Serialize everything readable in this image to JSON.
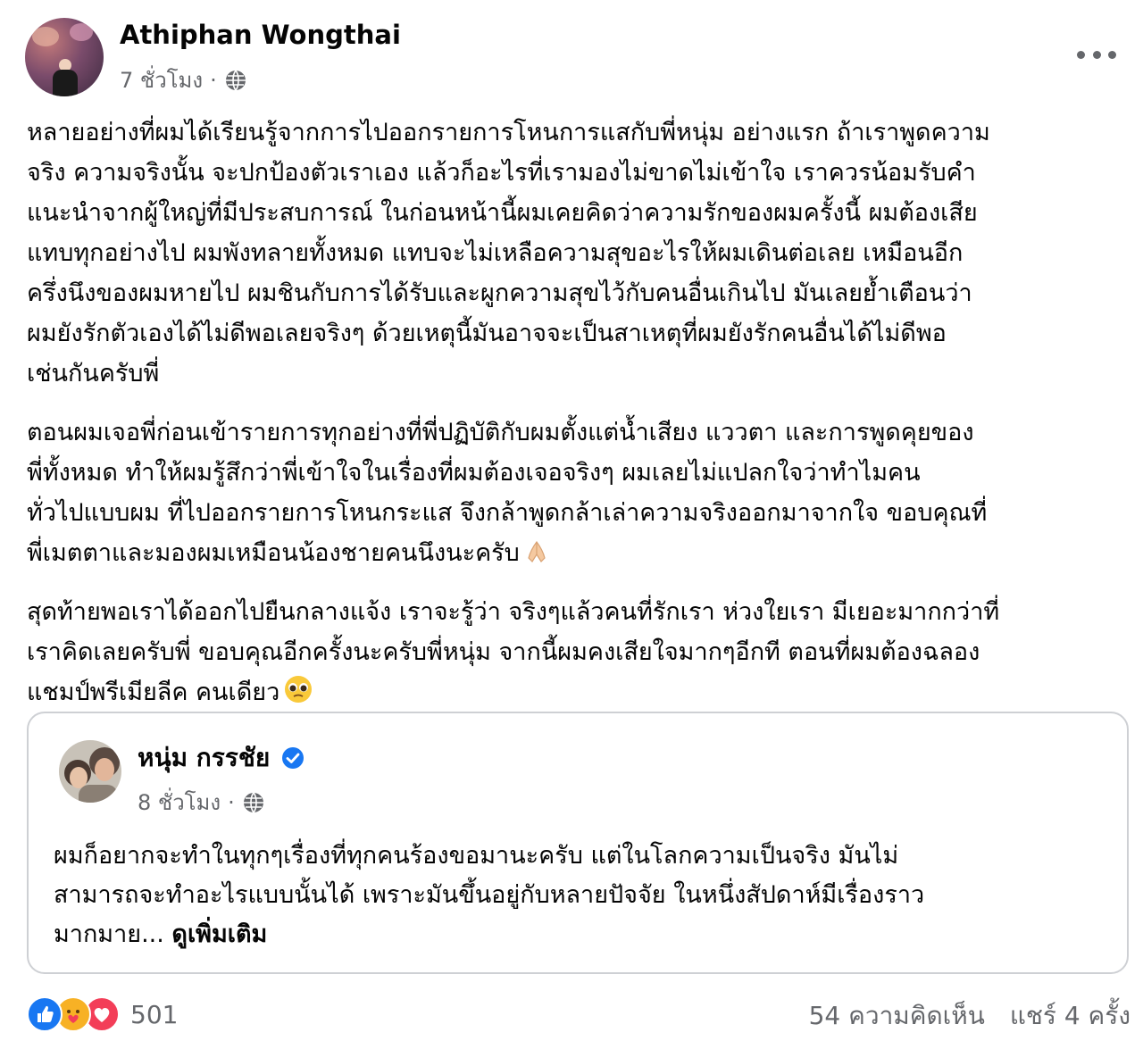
{
  "post": {
    "author": "Athiphan Wongthai",
    "time": "7 ชั่วโมง",
    "separator": "·",
    "paragraphs": [
      "หลายอย่างที่ผมได้เรียนรู้จากการไปออกรายการโหนการแสกับพี่หนุ่ม อย่างแรก ถ้าเราพูดความ\nจริง ความจริงนั้น จะปกป้องตัวเราเอง แล้วก็อะไรที่เรามองไม่ขาดไม่เข้าใจ เราควรน้อมรับคำ\nแนะนำจากผู้ใหญ่ที่มีประสบการณ์ ในก่อนหน้านี้ผมเคยคิดว่าความรักของผมครั้งนี้ ผมต้องเสีย\nแทบทุกอย่างไป ผมพังทลายทั้งหมด แทบจะไม่เหลือความสุขอะไรให้ผมเดินต่อเลย เหมือนอีก\nครึ่งนึงของผมหายไป ผมชินกับการได้รับและผูกความสุขไว้กับคนอื่นเกินไป มันเลยย้ำเตือนว่า\nผมยังรักตัวเองได้ไม่ดีพอเลยจริงๆ ด้วยเหตุนี้มันอาจจะเป็นสาเหตุที่ผมยังรักคนอื่นได้ไม่ดีพอ\nเช่นกันครับพี่",
      "ตอนผมเจอพี่ก่อนเข้ารายการทุกอย่างที่พี่ปฏิบัติกับผมตั้งแต่น้ำเสียง แววตา และการพูดคุยของ\nพี่ทั้งหมด ทำให้ผมรู้สึกว่าพี่เข้าใจในเรื่องที่ผมต้องเจอจริงๆ ผมเลยไม่แปลกใจว่าทำไมคน\nทั่วไปแบบผม ที่ไปออกรายการโหนกระแส จึงกล้าพูดกล้าเล่าความจริงออกมาจากใจ ขอบคุณที่\nพี่เมตตาและมองผมเหมือนน้องชายคนนึงนะครับ",
      "สุดท้ายพอเราได้ออกไปยืนกลางแจ้ง เราจะรู้ว่า จริงๆแล้วคนที่รักเรา ห่วงใยเรา มีเยอะมากกว่าที่\nเราคิดเลยครับพี่ ขอบคุณอีกครั้งนะครับพี่หนุ่ม จากนี้ผมคงเสียใจมากๆอีกที ตอนที่ผมต้องฉลอง\nแชมป์พรีเมียลีค คนเดียว"
    ],
    "emoji_1": "folded-hands-emoji",
    "emoji_2": "pleading-face-emoji"
  },
  "shared": {
    "author": "หนุ่ม กรรชัย",
    "time": "8 ชั่วโมง",
    "separator": "·",
    "text": "ผมก็อยากจะทำในทุกๆเรื่องที่ทุกคนร้องขอมานะครับ แต่ในโลกความเป็นจริง มันไม่\nสามารถจะทำอะไรแบบนั้นได้ เพราะมันขึ้นอยู่กับหลายปัจจัย  ในหนึ่งสัปดาห์มีเรื่องราว\nมากมาย... ",
    "see_more": "ดูเพิ่มเติม"
  },
  "footer": {
    "reaction_count": "501",
    "comments": "54 ความคิดเห็น",
    "shares": "แชร์ 4 ครั้ง"
  },
  "colors": {
    "like": "#1877f2",
    "care": "#f7b125",
    "love": "#f33e58",
    "verified": "#1877f2",
    "secondary_text": "#65676b"
  }
}
